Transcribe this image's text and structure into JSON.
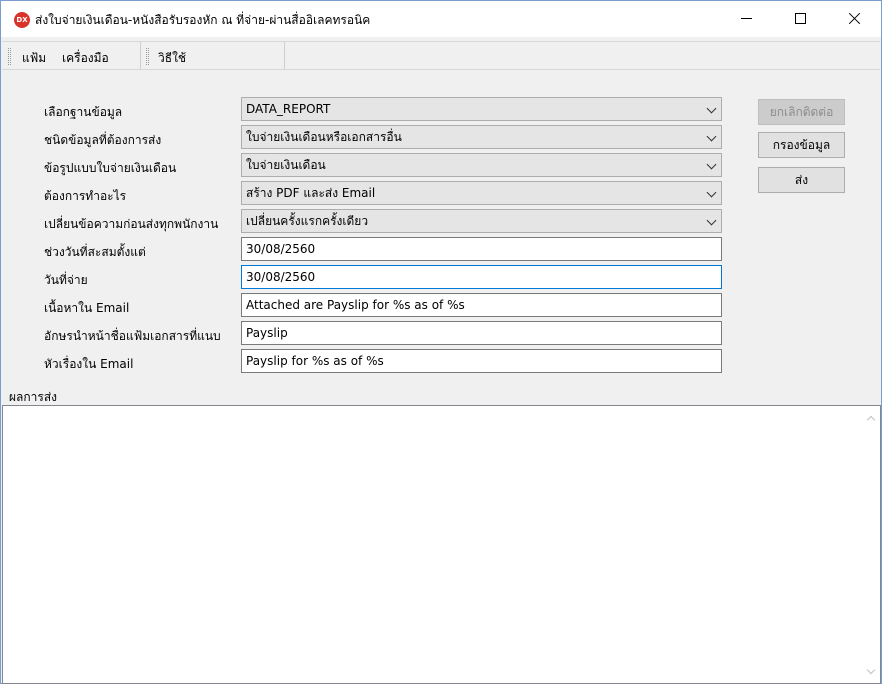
{
  "window": {
    "title": "ส่งใบจ่ายเงินเดือน-หนังสือรับรองหัก ณ ที่จ่าย-ผ่านสื่ออิเลคทรอนิค",
    "icon_text": "DX",
    "icon": "app-logo-icon",
    "controls": {
      "minimize": "minimize-icon",
      "maximize": "maximize-icon",
      "close": "close-icon"
    }
  },
  "menubar": {
    "items": [
      "แฟ้ม",
      "เครื่องมือ",
      "วิธีใช้"
    ]
  },
  "form": {
    "fields": [
      {
        "label": "เลือกฐานข้อมูล",
        "type": "select",
        "value": "DATA_REPORT"
      },
      {
        "label": "ชนิดข้อมูลที่ต้องการส่ง",
        "type": "select",
        "value": "ใบจ่ายเงินเดือนหรือเอกสารอื่น"
      },
      {
        "label": "ข้อรูปแบบใบจ่ายเงินเดือน",
        "type": "select",
        "value": "ใบจ่ายเงินเดือน"
      },
      {
        "label": "ต้องการทำอะไร",
        "type": "select",
        "value": "สร้าง PDF และส่ง Email"
      },
      {
        "label": "เปลี่ยนข้อความก่อนส่งทุกพนักงาน",
        "type": "select",
        "value": "เปลี่ยนครั้งแรกครั้งเดียว"
      },
      {
        "label": "ช่วงวันที่สะสมตั้งแต่",
        "type": "text",
        "value": "30/08/2560"
      },
      {
        "label": "วันที่จ่าย",
        "type": "text",
        "value": "30/08/2560"
      },
      {
        "label": "เนื้อหาใน Email",
        "type": "text",
        "value": "Attached are Payslip for %s as of %s"
      },
      {
        "label": "อักษรนำหน้าชื่อแฟ้มเอกสารที่แนบ",
        "type": "text",
        "value": "Payslip"
      },
      {
        "label": "หัวเรื่องใน Email",
        "type": "text",
        "value": "Payslip for %s as of %s"
      }
    ]
  },
  "buttons": {
    "cancel": "ยกเลิกติดต่อ",
    "filter": "กรองข้อมูล",
    "send": "ส่ง"
  },
  "result": {
    "label": "ผลการส่ง"
  }
}
